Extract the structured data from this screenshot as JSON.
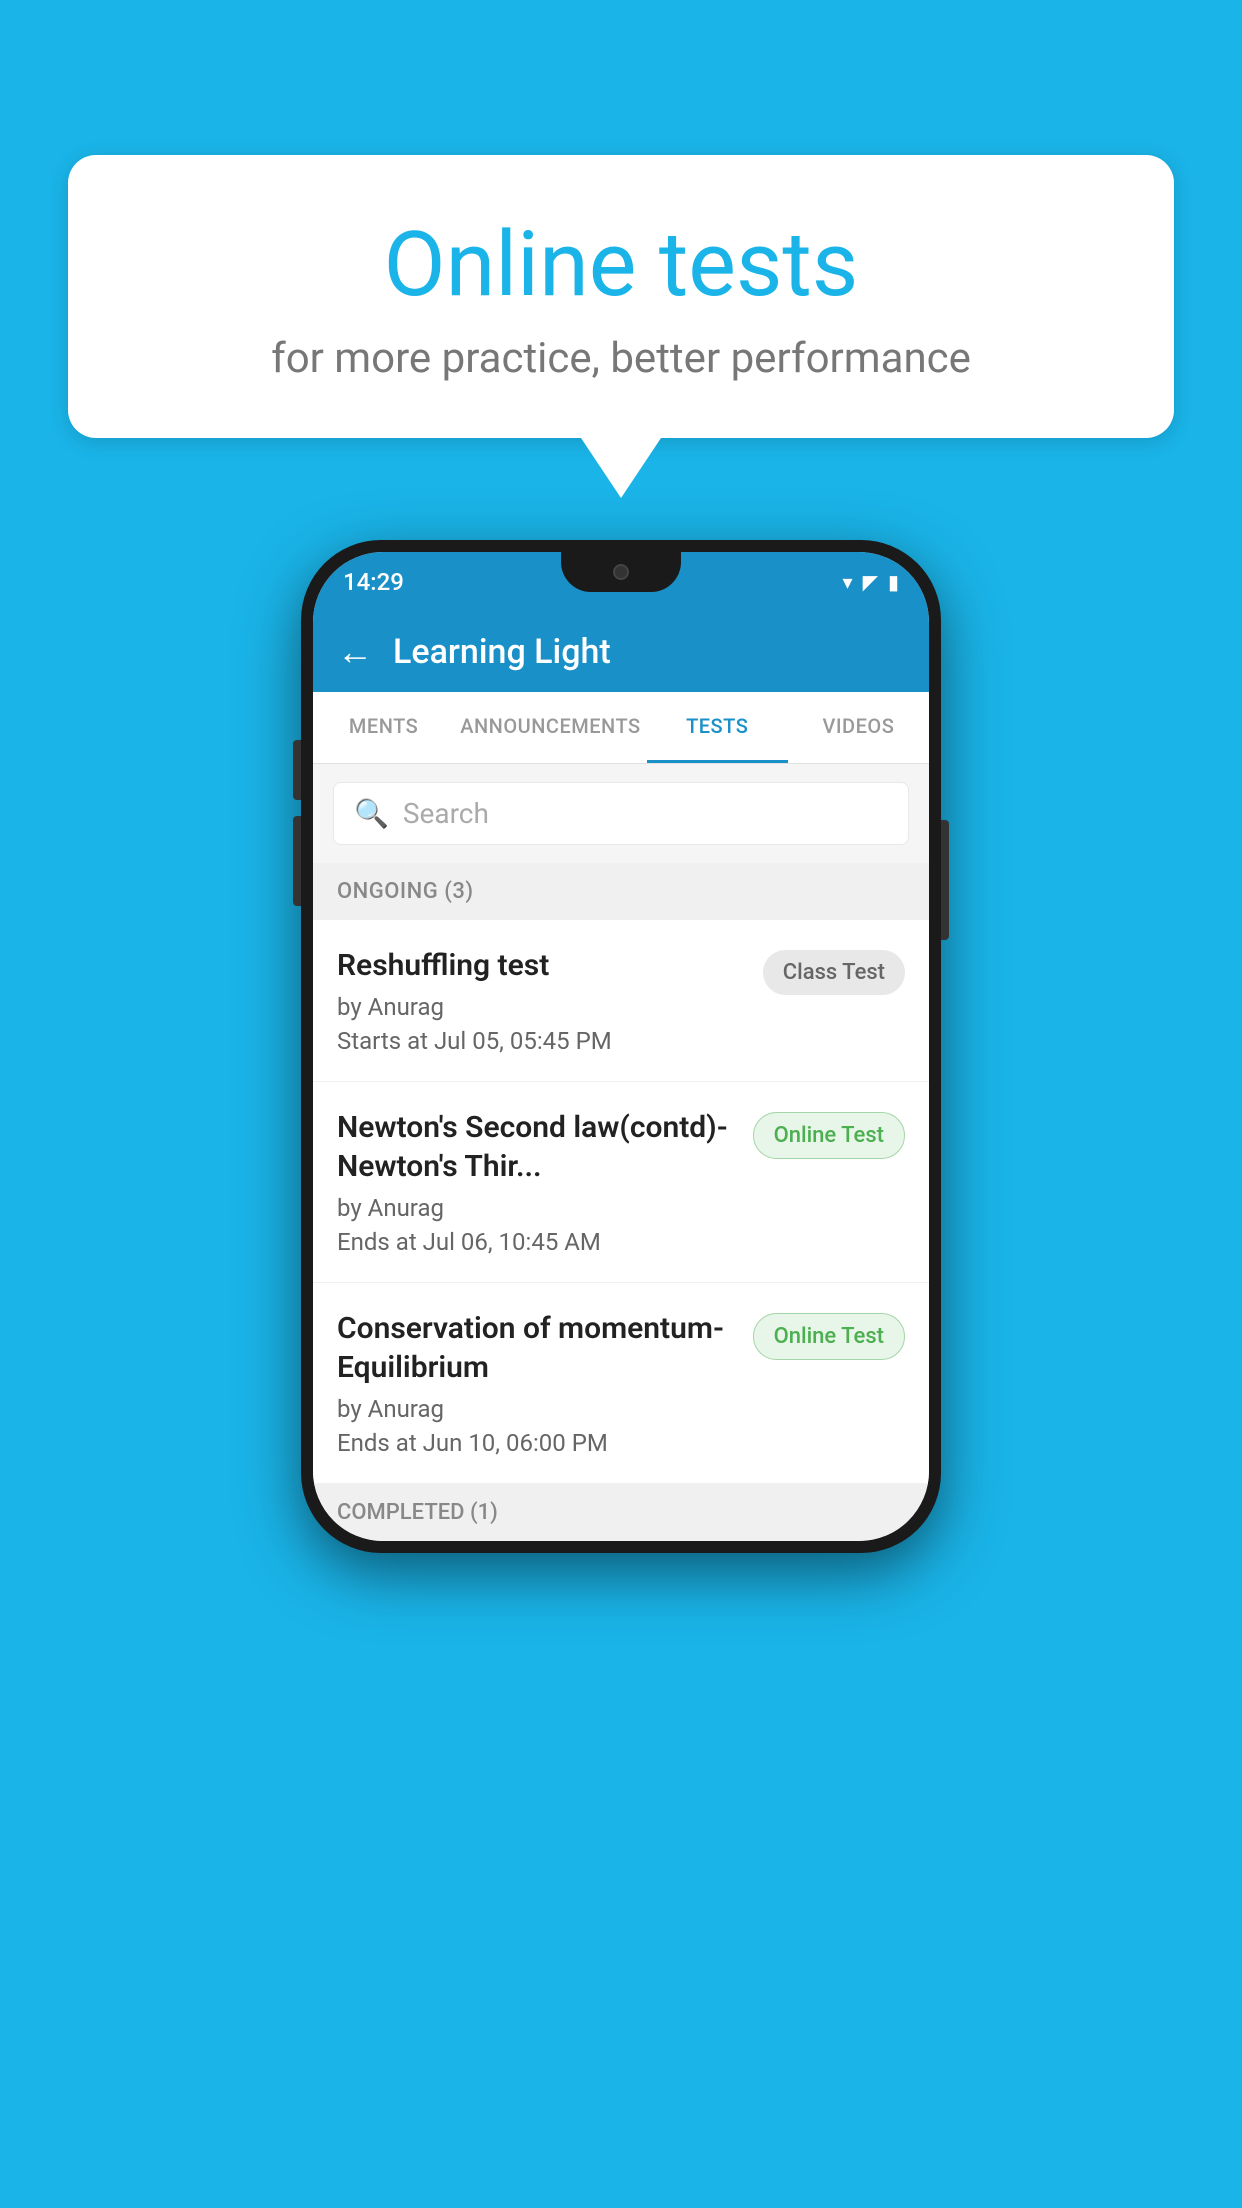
{
  "background_color": "#1ab4e8",
  "speech_bubble": {
    "title": "Online tests",
    "subtitle": "for more practice, better performance"
  },
  "phone": {
    "status_bar": {
      "time": "14:29",
      "icons": [
        "wifi",
        "signal",
        "battery"
      ]
    },
    "app_bar": {
      "back_label": "←",
      "title": "Learning Light"
    },
    "tabs": [
      {
        "label": "MENTS",
        "active": false
      },
      {
        "label": "ANNOUNCEMENTS",
        "active": false
      },
      {
        "label": "TESTS",
        "active": true
      },
      {
        "label": "VIDEOS",
        "active": false
      }
    ],
    "search": {
      "placeholder": "Search",
      "icon": "🔍"
    },
    "ongoing_section": {
      "label": "ONGOING (3)"
    },
    "tests": [
      {
        "title": "Reshuffling test",
        "author": "by Anurag",
        "date_label": "Starts at",
        "date": "Jul 05, 05:45 PM",
        "badge": "Class Test",
        "badge_type": "class"
      },
      {
        "title": "Newton's Second law(contd)-Newton's Thir...",
        "author": "by Anurag",
        "date_label": "Ends at",
        "date": "Jul 06, 10:45 AM",
        "badge": "Online Test",
        "badge_type": "online"
      },
      {
        "title": "Conservation of momentum-Equilibrium",
        "author": "by Anurag",
        "date_label": "Ends at",
        "date": "Jun 10, 06:00 PM",
        "badge": "Online Test",
        "badge_type": "online"
      }
    ],
    "completed_section": {
      "label": "COMPLETED (1)"
    }
  }
}
